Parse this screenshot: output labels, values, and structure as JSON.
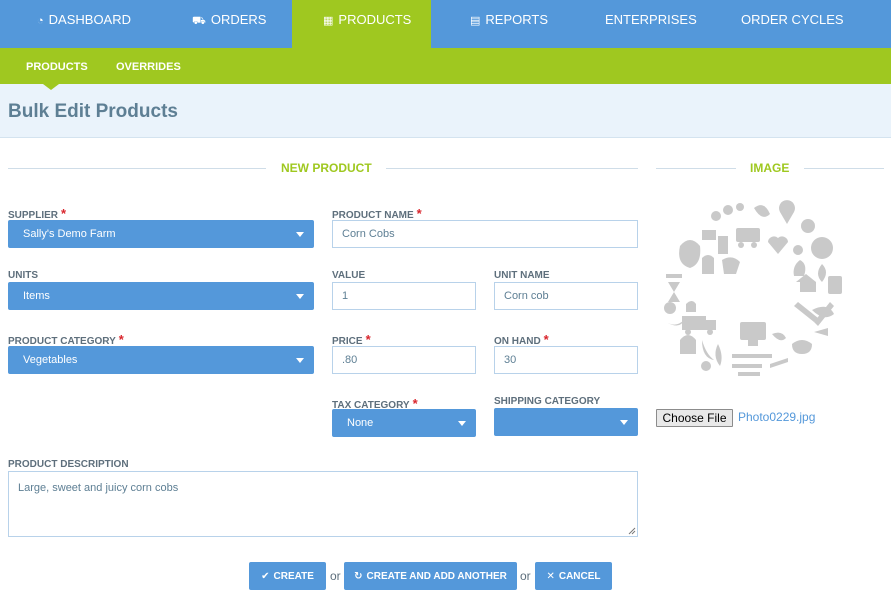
{
  "nav": {
    "items": [
      {
        "label": "DASHBOARD",
        "icon": "dashboard-icon",
        "glyph": "◔"
      },
      {
        "label": "ORDERS",
        "icon": "cart-icon",
        "glyph": "🛒"
      },
      {
        "label": "PRODUCTS",
        "icon": "grid-icon",
        "glyph": "▦",
        "active": true
      },
      {
        "label": "REPORTS",
        "icon": "document-icon",
        "glyph": "▤"
      },
      {
        "label": "ENTERPRISES",
        "icon": "",
        "glyph": ""
      },
      {
        "label": "ORDER CYCLES",
        "icon": "",
        "glyph": ""
      }
    ]
  },
  "subnav": {
    "items": [
      {
        "label": "PRODUCTS"
      },
      {
        "label": "OVERRIDES"
      }
    ]
  },
  "page": {
    "title": "Bulk Edit Products"
  },
  "sections": {
    "new_product": "NEW PRODUCT",
    "image": "IMAGE"
  },
  "form": {
    "supplier": {
      "label": "SUPPLIER",
      "required": "*",
      "value": "Sally's Demo Farm"
    },
    "product_name": {
      "label": "PRODUCT NAME",
      "required": "*",
      "value": "Corn Cobs"
    },
    "units": {
      "label": "UNITS",
      "value": "Items"
    },
    "value": {
      "label": "VALUE",
      "value": "1"
    },
    "unit_name": {
      "label": "UNIT NAME",
      "value": "Corn cob"
    },
    "product_category": {
      "label": "PRODUCT CATEGORY",
      "required": "*",
      "value": "Vegetables"
    },
    "price": {
      "label": "PRICE",
      "required": "*",
      "value": ".80"
    },
    "on_hand": {
      "label": "ON HAND",
      "required": "*",
      "value": "30"
    },
    "tax_category": {
      "label": "TAX CATEGORY",
      "required": "*",
      "value": "None"
    },
    "shipping_category": {
      "label": "SHIPPING CATEGORY",
      "value": ""
    },
    "description": {
      "label": "PRODUCT DESCRIPTION",
      "value": "Large, sweet and juicy corn cobs"
    }
  },
  "image": {
    "choose_file_label": "Choose File",
    "file_name": "Photo0229.jpg",
    "placeholder_icon": "produce-illustration-icon"
  },
  "actions": {
    "create": {
      "label": "CREATE",
      "icon": "check-icon"
    },
    "create_another": {
      "label": "CREATE AND ADD ANOTHER",
      "icon": "refresh-icon"
    },
    "cancel": {
      "label": "CANCEL",
      "icon": "close-icon"
    },
    "or": "or"
  },
  "colors": {
    "nav_blue": "#5498da",
    "accent_green": "#9fc820",
    "required_red": "#d9252c",
    "header_bg": "#eaf3fb"
  }
}
